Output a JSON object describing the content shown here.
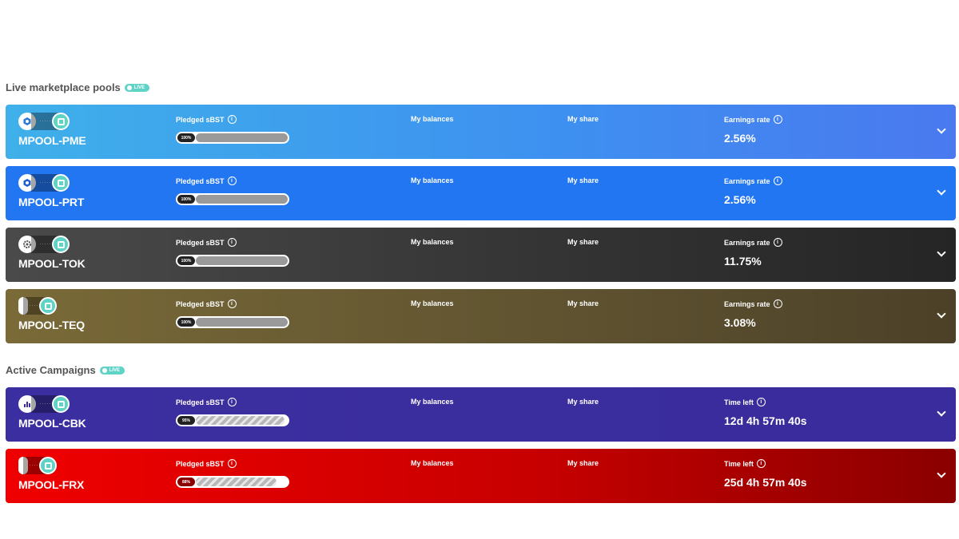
{
  "sections": {
    "live_title": "Live marketplace pools",
    "campaigns_title": "Active Campaigns",
    "live_badge": "LIVE"
  },
  "labels": {
    "pledged": "Pledged sBST",
    "balances": "My balances",
    "share": "My share",
    "earnings": "Earnings rate",
    "time_left": "Time left"
  },
  "pools": [
    {
      "name": "MPOOL-PME",
      "pct": "100%",
      "value": "2.56%",
      "bg": "#3fa0e8",
      "icon": "hexagon-icon"
    },
    {
      "name": "MPOOL-PRT",
      "pct": "100%",
      "value": "2.56%",
      "bg": "#2276f2",
      "icon": "hexagon-icon"
    },
    {
      "name": "MPOOL-TOK",
      "pct": "100%",
      "value": "11.75%",
      "bg": "#3a3a3a",
      "icon": "gear-icon"
    },
    {
      "name": "MPOOL-TEQ",
      "pct": "100%",
      "value": "3.08%",
      "bg": "#6e6035",
      "icon": "bar-icon"
    }
  ],
  "campaigns": [
    {
      "name": "MPOOL-CBK",
      "pct": "95%",
      "value": "12d 4h 57m 40s",
      "bg": "#3b2ea0",
      "icon": "chart-icon"
    },
    {
      "name": "MPOOL-FRX",
      "pct": "88%",
      "value": "25d 4h 57m 40s",
      "bg": "#e00000",
      "icon": "bar-icon"
    }
  ]
}
